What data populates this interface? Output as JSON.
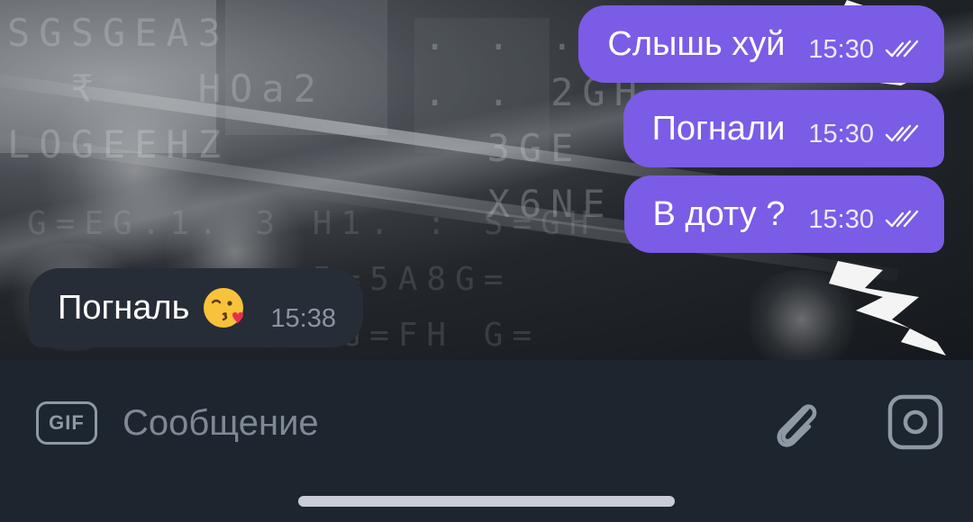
{
  "messages": [
    {
      "direction": "outgoing",
      "text": "Слышь хуй",
      "time": "15:30",
      "status": "double-check-icon"
    },
    {
      "direction": "outgoing",
      "text": "Погнали",
      "time": "15:30",
      "status": "double-check-icon"
    },
    {
      "direction": "outgoing",
      "text": "В доту ?",
      "time": "15:30",
      "status": "double-check-icon"
    },
    {
      "direction": "incoming",
      "text": "Погналь",
      "emoji": "kissing-heart-face",
      "time": "15:38"
    }
  ],
  "composer": {
    "gif_label": "GIF",
    "placeholder": "Сообщение",
    "attach_icon": "paperclip-icon",
    "camera_icon": "camera-icon"
  },
  "colors": {
    "outgoing_bubble": "#7a5ce6",
    "incoming_bubble": "#262d36",
    "input_bar": "#1d252f"
  }
}
